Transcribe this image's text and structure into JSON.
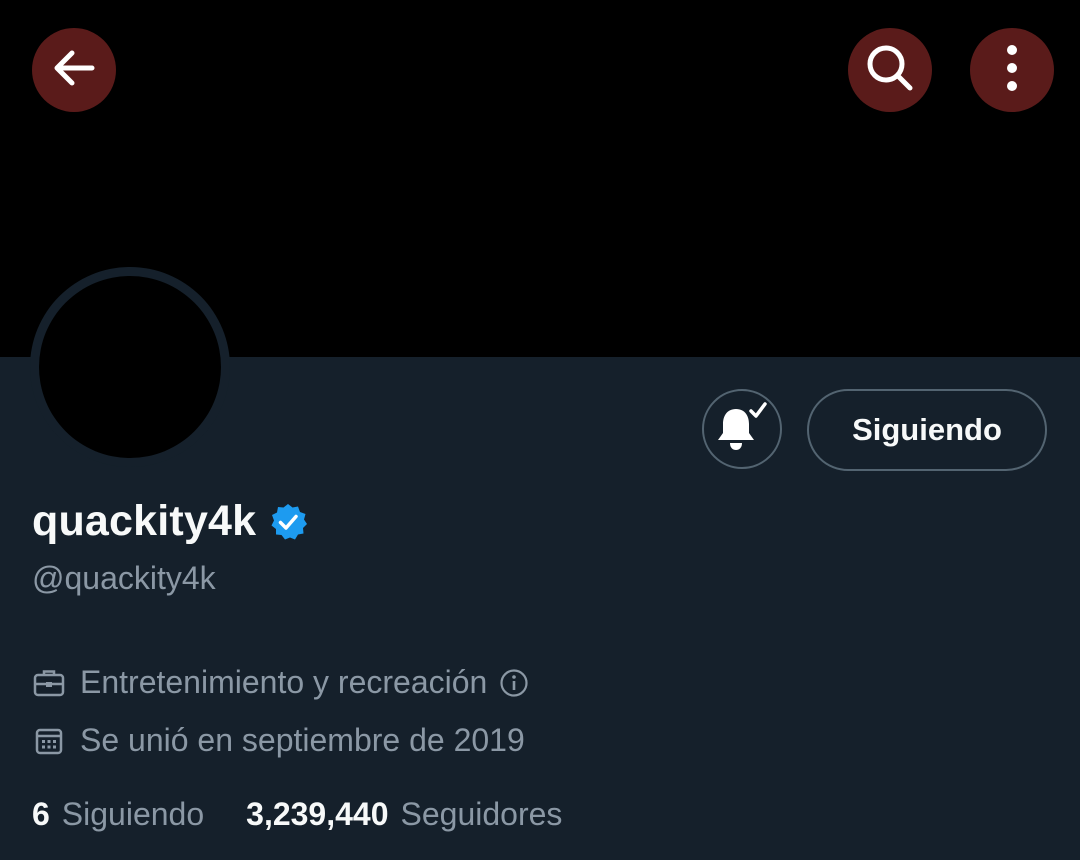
{
  "header": {
    "back_icon": "arrow-left-icon",
    "search_icon": "search-icon",
    "more_icon": "more-vertical-icon",
    "button_bg": "#5a1b1a"
  },
  "profile": {
    "display_name": "quackity4k",
    "verified": true,
    "verified_color": "#1d9bf0",
    "handle": "@quackity4k",
    "category": "Entretenimiento y recreación",
    "joined": "Se unió en septiembre de 2019"
  },
  "actions": {
    "notifications_icon": "bell-check-icon",
    "following_label": "Siguiendo"
  },
  "stats": {
    "following_count": "6",
    "following_label": "Siguiendo",
    "followers_count": "3,239,440",
    "followers_label": "Seguidores"
  },
  "colors": {
    "background": "#15202b",
    "banner": "#000000",
    "text_primary": "#f7f9f9",
    "text_secondary": "#8b98a5"
  }
}
